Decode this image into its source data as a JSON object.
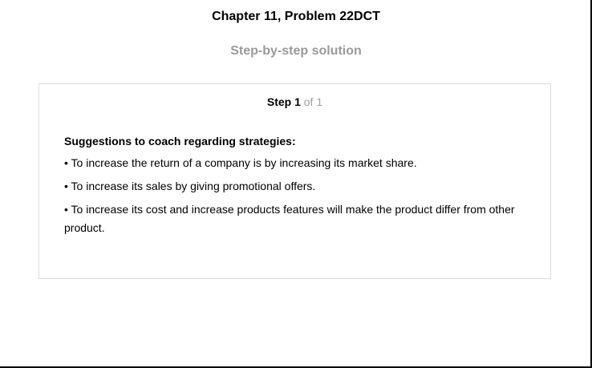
{
  "header": {
    "title": "Chapter 11, Problem 22DCT",
    "subtitle": "Step-by-step solution"
  },
  "step": {
    "label": "Step 1",
    "of_text": "of 1",
    "heading": "Suggestions to coach regarding strategies:",
    "bullets": [
      "• To increase the return of a company is by increasing its market share.",
      "• To increase its sales by giving promotional offers.",
      "• To increase its cost and increase products features will make the product differ from other product."
    ]
  }
}
